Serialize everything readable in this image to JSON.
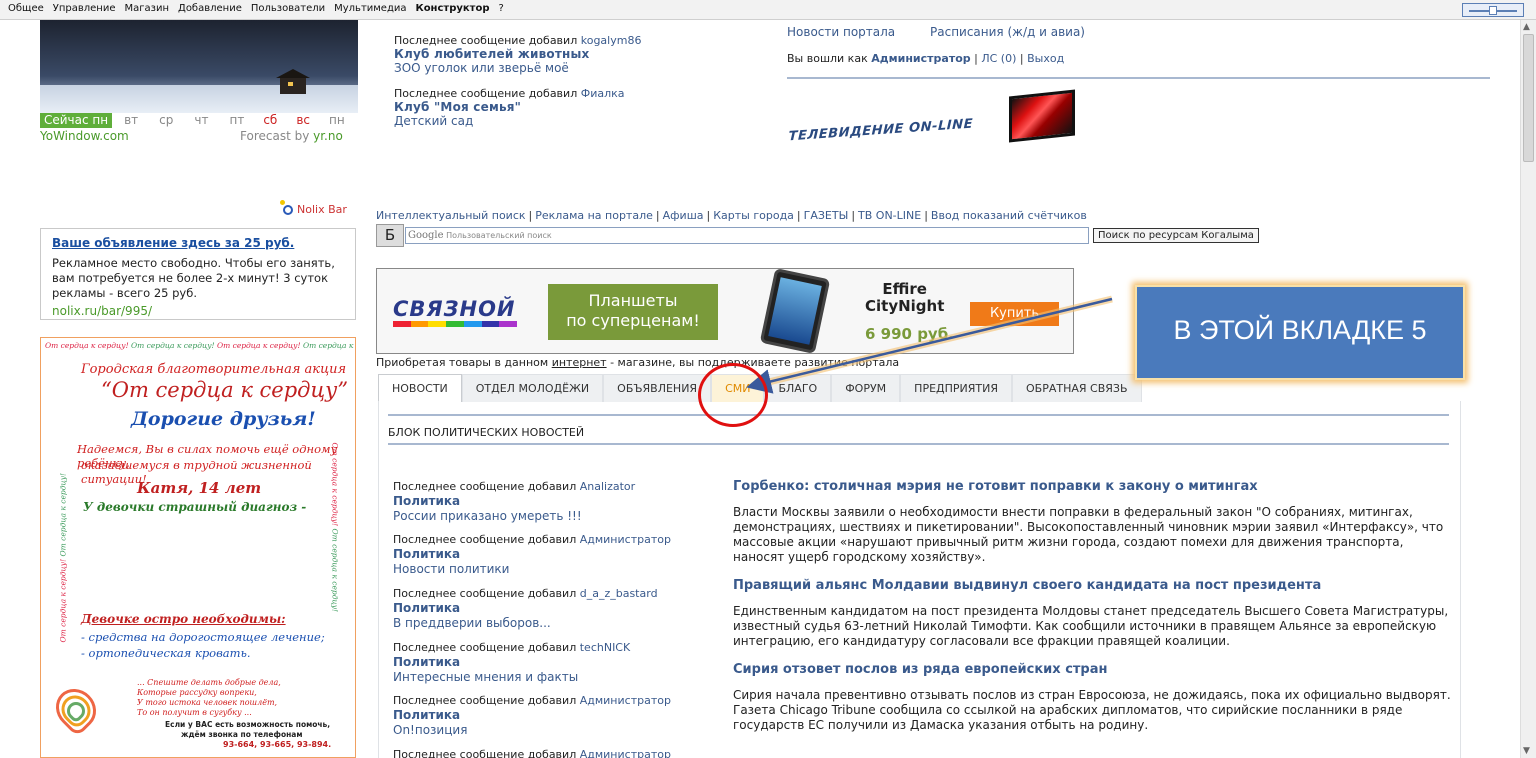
{
  "adminbar": {
    "items": [
      "Общее",
      "Управление",
      "Магазин",
      "Добавление",
      "Пользователи",
      "Мультимедиа",
      "Конструктор",
      "?"
    ]
  },
  "weather": {
    "days": [
      "Сейчас пн",
      "вт",
      "ср",
      "чт",
      "пт",
      "сб",
      "вс",
      "пн"
    ],
    "yowindow": "YoWindow.com",
    "forecast_prefix": "Forecast by ",
    "forecast_link": "yr.no"
  },
  "top_messages": [
    {
      "prefix": "Последнее сообщение добавил",
      "author": "kogalym86",
      "title": "Клуб любителей животных",
      "subtitle": "ЗОО уголок или зверьё моё"
    },
    {
      "prefix": "Последнее сообщение добавил",
      "author": "Фиалка",
      "title": "Клуб \"Моя семья\"",
      "subtitle": "Детский сад"
    }
  ],
  "top_right": {
    "link1": "Новости портала",
    "link2": "Расписания (ж/д и авиа)",
    "logged_prefix": "Вы вошли как",
    "user": "Администратор",
    "ls": "ЛС (0)",
    "exit": "Выход",
    "tv_text": "ТЕЛЕВИДЕНИЕ ON-LINE"
  },
  "nolix": {
    "bar_label": "Nolix Bar",
    "ad_title": "Ваше объявление здесь за 25 руб.",
    "ad_text": "Рекламное место свободно. Чтобы его занять, вам потребуется не более 2-х минут! 3 суток рекламы - всего 25 руб.",
    "ad_url": "nolix.ru/bar/995/"
  },
  "poster": {
    "frame_text": "От сердца к сердцу!",
    "line1": "Городская благотворительная акция",
    "line2": "“От сердца к сердцу”",
    "line3": "Дорогие друзья!",
    "line4": "Надеемся, Вы в силах помочь ещё одному ребёнку,",
    "line5": "оказавшемуся в трудной жизненной ситуации!",
    "line6": "Катя, 14 лет",
    "line7": "У девочки страшный диагноз -",
    "line8": "Девочке остро необходимы:",
    "line9": "- средства на дорогостоящее лечение;",
    "line10": "- ортопедическая кровать.",
    "line11": "... Спешите делать добрые дела,",
    "line12": "Которые рассудку вопреки,",
    "line13": "У того истока человек пошлёт,",
    "line14": "То он получит в сугубку ...",
    "line15": "Если у ВАС есть возможность помочь,",
    "line16": "ждём звонка по телефонам",
    "line17": "93-664, 93-665, 93-894."
  },
  "nav_links": [
    "Интеллектуальный поиск",
    "Реклама на портале",
    "Афиша",
    "Карты города",
    "ГАЗЕТЫ",
    "ТВ ON-LINE",
    "Ввод показаний счётчиков"
  ],
  "search": {
    "b_button": "Б",
    "google": "Google",
    "placeholder": "Пользовательский поиск",
    "button": "Поиск по ресурсам Когалыма"
  },
  "banner": {
    "logo": "СВЯЗНОЙ",
    "slogan1": "Планшеты",
    "slogan2": "по суперценам!",
    "model1": "Effire",
    "model2": "CityNight",
    "price": "6 990 руб.",
    "buy": "Купить",
    "note_prefix": "Приобретая товары в данном ",
    "note_link": "интернет",
    "note_suffix": " - магазине, вы поддерживаете развитие портала"
  },
  "tabs": [
    "НОВОСТИ",
    "ОТДЕЛ МОЛОДЁЖИ",
    "ОБЪЯВЛЕНИЯ",
    "СМИ",
    "БЛАГО",
    "ФОРУМ",
    "ПРЕДПРИЯТИЯ",
    "ОБРАТНАЯ СВЯЗЬ"
  ],
  "block_title": "БЛОК ПОЛИТИЧЕСКИХ НОВОСТЕЙ",
  "forum": [
    {
      "prefix": "Последнее сообщение добавил",
      "author": "Analizator",
      "title": "Политика",
      "subtitle": "России приказано умереть !!!"
    },
    {
      "prefix": "Последнее сообщение добавил",
      "author": "Администратор",
      "title": "Политика",
      "subtitle": "Новости политики"
    },
    {
      "prefix": "Последнее сообщение добавил",
      "author": "d_a_z_bastard",
      "title": "Политика",
      "subtitle": "В преддверии выборов..."
    },
    {
      "prefix": "Последнее сообщение добавил",
      "author": "techNICK",
      "title": "Политика",
      "subtitle": "Интересные мнения и факты"
    },
    {
      "prefix": "Последнее сообщение добавил",
      "author": "Администратор",
      "title": "Политика",
      "subtitle": "On!позиция"
    },
    {
      "prefix": "Последнее сообщение добавил",
      "author": "Администратор",
      "title": "",
      "subtitle": ""
    }
  ],
  "news": [
    {
      "title": "Горбенко: столичная мэрия не готовит поправки к закону о митингах",
      "text": "Власти Москвы заявили о необходимости внести поправки в федеральный закон \"О собраниях, митингах, демонстрациях, шествиях и пикетировании\". Высокопоставленный чиновник мэрии заявил «Интерфаксу», что массовые акции «нарушают привычный ритм жизни города, создают помехи для движения транспорта, наносят ущерб городскому хозяйству»."
    },
    {
      "title": "Правящий альянс Молдавии выдвинул своего кандидата на пост президента",
      "text": "Единственным кандидатом на пост президента Молдовы станет председатель Высшего Совета Магистратуры, известный судья 63-летний Николай Тимофти. Как сообщили источники в правящем Альянсе за европейскую интеграцию, его кандидатуру согласовали все фракции правящей коалиции."
    },
    {
      "title": "Сирия отзовет послов из ряда европейских стран",
      "text": "Сирия начала превентивно отзывать послов из стран Евросоюза, не дожидаясь, пока их официально выдворят. Газета Chicago Tribune сообщила со ссылкой на арабских дипломатов, что сирийские посланники в ряде государств ЕС получили из Дамаска указания отбыть на родину."
    }
  ],
  "callout": {
    "text": "В ЭТОЙ ВКЛАДКЕ 5",
    "color": "#4a7abc"
  },
  "colors": {
    "link": "#3a5a8c",
    "annotation_red": "#e01010",
    "smi_tab": "#e08a00"
  }
}
